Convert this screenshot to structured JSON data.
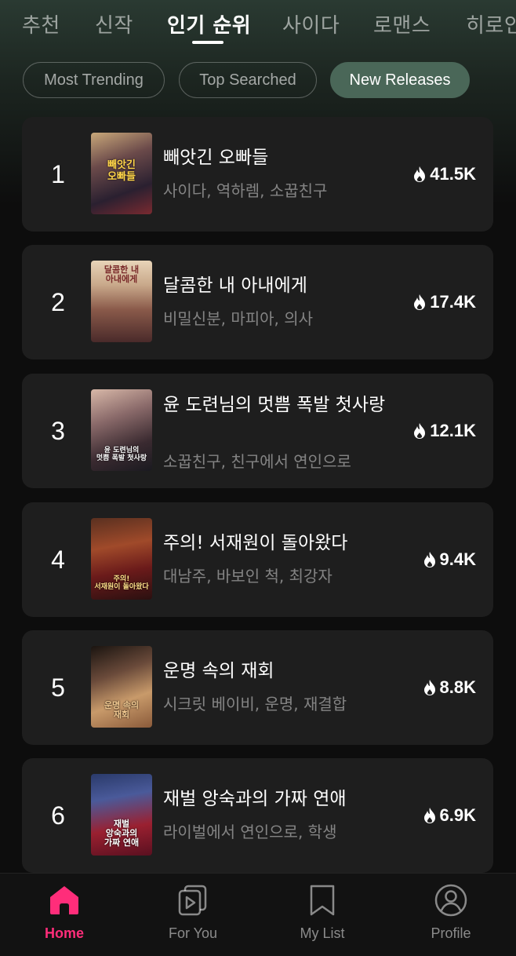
{
  "category_tabs": [
    "추천",
    "신작",
    "인기 순위",
    "사이다",
    "로맨스",
    "히로인"
  ],
  "active_category": "인기 순위",
  "filter_chips": [
    "Most Trending",
    "Top Searched",
    "New Releases"
  ],
  "active_chip": "New Releases",
  "rankings": [
    {
      "rank": "1",
      "title": "빼앗긴 오빠들",
      "tags": "사이다, 역하렘, 소꿉친구",
      "views": "41.5K",
      "poster_text": "빼앗긴\n오빠들"
    },
    {
      "rank": "2",
      "title": "달콤한 내 아내에게",
      "tags": "비밀신분, 마피아, 의사",
      "views": "17.4K",
      "poster_text": "달콤한 내\n아내에게"
    },
    {
      "rank": "3",
      "title": "윤 도련님의 멋쁨 폭발 첫사랑",
      "tags": "소꿉친구, 친구에서 연인으로",
      "views": "12.1K",
      "poster_text": "윤 도련님의\n멋쁨 폭발 첫사랑"
    },
    {
      "rank": "4",
      "title": "주의! 서재원이 돌아왔다",
      "tags": "대남주, 바보인 척, 최강자",
      "views": "9.4K",
      "poster_text": "주의!\n서재원이 돌아왔다"
    },
    {
      "rank": "5",
      "title": "운명 속의 재회",
      "tags": "시크릿 베이비, 운명, 재결합",
      "views": "8.8K",
      "poster_text": "운명 속의\n재회"
    },
    {
      "rank": "6",
      "title": "재벌 앙숙과의 가짜 연애",
      "tags": "라이벌에서 연인으로, 학생",
      "views": "6.9K",
      "poster_text": "재벌\n앙숙과의\n가짜 연애"
    }
  ],
  "bottom_nav": [
    {
      "label": "Home",
      "icon": "home-icon",
      "active": true
    },
    {
      "label": "For You",
      "icon": "play-stack-icon",
      "active": false
    },
    {
      "label": "My List",
      "icon": "bookmark-icon",
      "active": false
    },
    {
      "label": "Profile",
      "icon": "profile-icon",
      "active": false
    }
  ],
  "colors": {
    "accent": "#ff2d7a",
    "chip_active": "#4a6758",
    "card_bg": "#1e1e1e"
  }
}
